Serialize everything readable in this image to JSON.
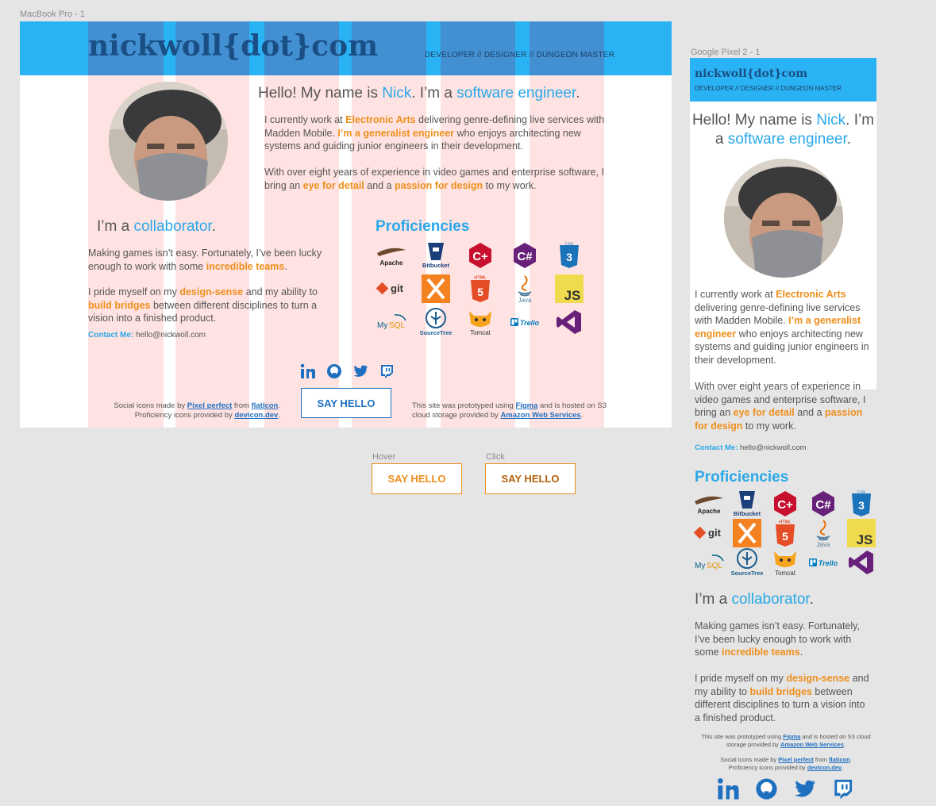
{
  "frames": {
    "desktop": "MacBook Pro - 1",
    "mobile": "Google Pixel 2 - 1"
  },
  "site": {
    "logo": "nickwoll{dot}com",
    "tagline": "DEVELOPER // DESIGNER // DUNGEON MASTER"
  },
  "intro": {
    "hello_a": "Hello! My name is ",
    "name": "Nick",
    "hello_b": ". I’m a ",
    "role": "software engineer",
    "period": "."
  },
  "work": {
    "p1_a": "I currently work at ",
    "company": "Electronic Arts",
    "p1_b": " delivering genre-defining live services with Madden Mobile. ",
    "p1_c": "I’m a generalist engineer",
    "p1_d": " who enjoys architecting new systems and guiding junior engineers in their development.",
    "p2_a": "With over eight years of experience in video games and enterprise software, I bring an ",
    "p2_b": "eye for detail",
    "p2_c": " and a ",
    "p2_d": "passion for design",
    "p2_e": " to my work."
  },
  "collab": {
    "title_a": "I’m a ",
    "title_b": "collaborator",
    "title_c": ".",
    "p1_a": "Making games isn’t easy. Fortunately, I’ve been lucky enough to work with some ",
    "p1_b": "incredible teams",
    "p1_c": ".",
    "p2_a": "I pride myself on my ",
    "p2_b": "design-sense",
    "p2_c": " and my ability to ",
    "p2_d": "build bridges",
    "p2_e": " between different disciplines to turn a vision into a finished product."
  },
  "contact": {
    "label": "Contact Me:",
    "email": "hello@nickwoll.com"
  },
  "proficiencies": {
    "title": "Proficiencies",
    "icons": [
      "Apache",
      "Bitbucket",
      "C++",
      "C#",
      "CSS3",
      "git",
      "Xamarin",
      "HTML5",
      "Java",
      "JS",
      "MySQL",
      "SourceTree",
      "Tomcat",
      "Trello",
      "Visual Studio"
    ]
  },
  "cta": {
    "label": "SAY HELLO",
    "hover_caption": "Hover",
    "click_caption": "Click"
  },
  "credits": {
    "social_a": "Social icons made by ",
    "social_link1": "Pixel perfect",
    "social_b": " from ",
    "social_link2": "flaticon",
    "social_c": ".",
    "prof_a": "Proficiency icons provided by ",
    "prof_link": "devicon.dev",
    "prof_c": ".",
    "site_a": "This site was prototyped using ",
    "site_link1": "Figma",
    "site_b": " and is hosted on S3 cloud storage provided by ",
    "site_link2": "Amazon Web Services",
    "site_c": "."
  },
  "social": [
    "linkedin-icon",
    "github-icon",
    "twitter-icon",
    "twitch-icon"
  ],
  "colors": {
    "accent": "#2ab3f4",
    "highlight": "#29a8e8",
    "orange": "#ee8f1c",
    "link": "#1e6fc0",
    "logo": "#1a4f86"
  }
}
